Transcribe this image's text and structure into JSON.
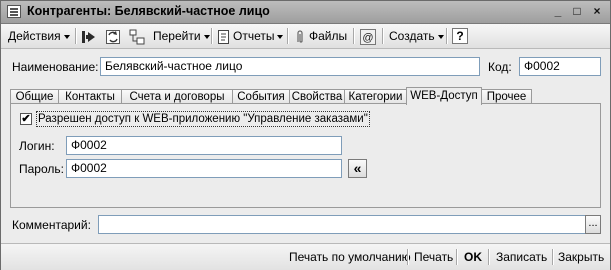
{
  "window": {
    "title": "Контрагенты: Белявский-частное лицо",
    "controls": {
      "minimize": "_",
      "maximize": "□",
      "close": "×"
    }
  },
  "toolbar": {
    "actions_label": "Действия",
    "goto_label": "Перейти",
    "reports_label": "Отчеты",
    "files_label": "Файлы",
    "create_label": "Создать",
    "help_label": "?"
  },
  "form": {
    "name_label": "Наименование:",
    "name_value": "Белявский-частное лицо",
    "code_label": "Код:",
    "code_value": "Ф0002"
  },
  "tabs": [
    {
      "label": "Общие"
    },
    {
      "label": "Контакты"
    },
    {
      "label": "Счета и договоры"
    },
    {
      "label": "События"
    },
    {
      "label": "Свойства"
    },
    {
      "label": "Категории"
    },
    {
      "label": "WEB-Доступ"
    },
    {
      "label": "Прочее"
    }
  ],
  "active_tab": "WEB-Доступ",
  "web_access": {
    "checkbox_label": "Разрешен доступ к WEB-приложению \"Управление заказами\"",
    "checkbox_checked": true,
    "checkbox_mark": "✔",
    "login_label": "Логин:",
    "login_value": "Ф0002",
    "password_label": "Пароль:",
    "password_value": "Ф0002",
    "copy_button": "«"
  },
  "comment": {
    "label": "Комментарий:",
    "value": "",
    "select_button": "..."
  },
  "footer": {
    "print_default": "Печать по умолчанию",
    "print": "Печать",
    "ok": "OK",
    "save": "Записать",
    "close": "Закрыть"
  }
}
